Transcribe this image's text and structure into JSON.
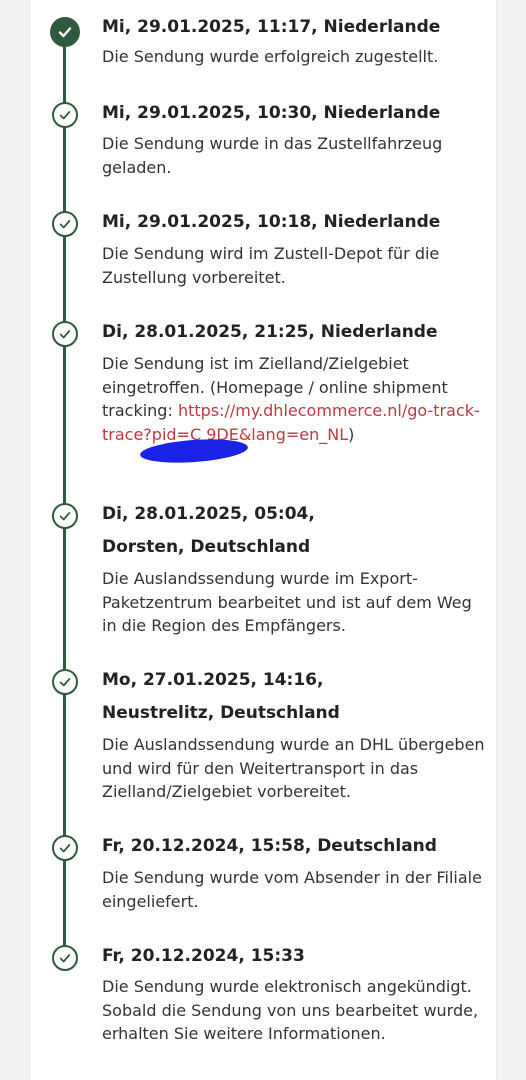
{
  "colors": {
    "timeline": "#2f5a3e",
    "link": "#c0393d",
    "redaction": "#1a22e6"
  },
  "events": [
    {
      "title": "Mi, 29.01.2025, 11:17, Niederlande",
      "description": "Die Sendung wurde erfolgreich zugestellt.",
      "status": "current"
    },
    {
      "title": "Mi, 29.01.2025, 10:30, Niederlande",
      "description": "Die Sendung wurde in das Zustellfahrzeug geladen."
    },
    {
      "title": "Mi, 29.01.2025, 10:18, Niederlande",
      "description": "Die Sendung wird im Zustell-Depot für die Zustellung vorbereitet."
    },
    {
      "title": "Di, 28.01.2025, 21:25, Niederlande",
      "description": "Die Sendung ist im Zielland/Zielgebiet eingetroffen. (Homepage / online shipment tracking: ",
      "link_text": "https://my.dhlecommerce.nl/go-track-trace?pid=C",
      "link_text_end": "9DE&lang=en_NL",
      "description_end": ")"
    },
    {
      "title": "Di, 28.01.2025, 05:04, Dorsten, Deutschland",
      "description": "Die Auslandssendung wurde im Export-Paketzentrum bearbeitet und ist auf dem Weg in die Region des Empfängers."
    },
    {
      "title": "Mo, 27.01.2025, 14:16, Neustrelitz, Deutschland",
      "description": "Die Auslandssendung wurde an DHL übergeben und wird für den Weitertransport in das Zielland/Zielgebiet vorbereitet."
    },
    {
      "title": "Fr, 20.12.2024, 15:58, Deutschland",
      "description": "Die Sendung wurde vom Absender in der Filiale eingeliefert."
    },
    {
      "title": "Fr, 20.12.2024, 15:33",
      "description": "Die Sendung wurde elektronisch angekündigt. Sobald die Sendung von uns bearbeitet wurde, erhalten Sie weitere Informationen."
    }
  ]
}
